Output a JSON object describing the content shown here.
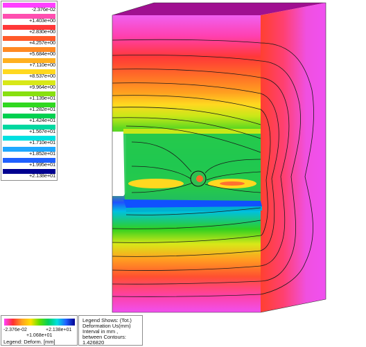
{
  "legend": {
    "entries": [
      {
        "label": "-2.376e-02",
        "color": "#ff40ff"
      },
      {
        "label": "+1.403e+00",
        "color": "#ff4fb0"
      },
      {
        "label": "+2.830e+00",
        "color": "#ff3838"
      },
      {
        "label": "+4.257e+00",
        "color": "#ff5a2a"
      },
      {
        "label": "+5.684e+00",
        "color": "#ff8a24"
      },
      {
        "label": "+7.110e+00",
        "color": "#ffb020"
      },
      {
        "label": "+8.537e+00",
        "color": "#ffd820"
      },
      {
        "label": "+9.964e+00",
        "color": "#d8e818"
      },
      {
        "label": "+1.139e+01",
        "color": "#88e010"
      },
      {
        "label": "+1.282e+01",
        "color": "#30d820"
      },
      {
        "label": "+1.424e+01",
        "color": "#00d050"
      },
      {
        "label": "+1.567e+01",
        "color": "#00d8a0"
      },
      {
        "label": "+1.710e+01",
        "color": "#00e0e0"
      },
      {
        "label": "+1.852e+01",
        "color": "#20a8ff"
      },
      {
        "label": "+1.995e+01",
        "color": "#2060ff"
      },
      {
        "label": "+2.138e+01",
        "color": "#000090"
      }
    ]
  },
  "colorbar": {
    "min_label": "-2.376e-02",
    "max_label": "+2.138e+01",
    "mid_label": "+1.068e+01",
    "caption": "Legend: Deform. [mm]"
  },
  "info": {
    "lines": [
      "Legend Shows: (Tot.)",
      "Deformation Us(mm)",
      "Interval in mm ,",
      "between Contours:",
      "1.426820"
    ]
  },
  "colors": {
    "top_face": "#a01090",
    "side_face": "#f050e0",
    "contour_line": "#1a1a1a"
  }
}
